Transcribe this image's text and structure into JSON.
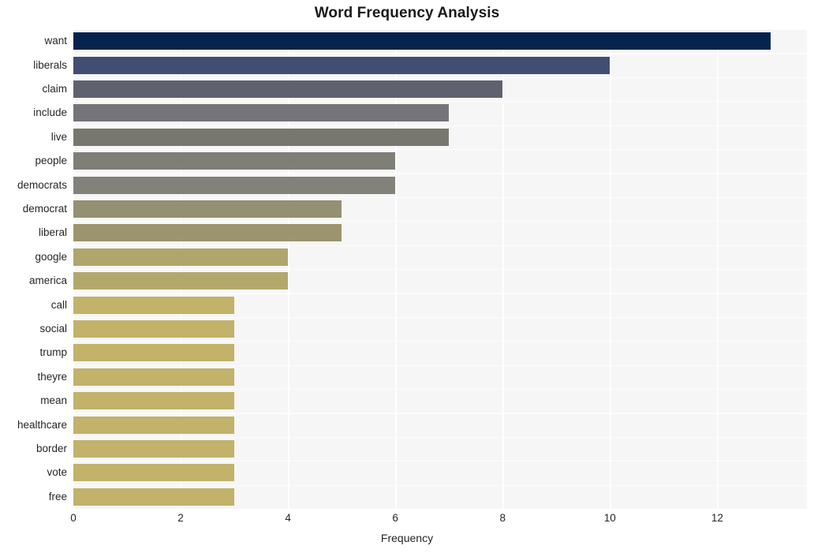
{
  "chart_data": {
    "type": "bar",
    "orientation": "horizontal",
    "title": "Word Frequency Analysis",
    "xlabel": "Frequency",
    "ylabel": "",
    "categories": [
      "want",
      "liberals",
      "claim",
      "include",
      "live",
      "people",
      "democrats",
      "democrat",
      "liberal",
      "google",
      "america",
      "call",
      "social",
      "trump",
      "theyre",
      "mean",
      "healthcare",
      "border",
      "vote",
      "free"
    ],
    "values": [
      13,
      10,
      8,
      7,
      7,
      6,
      6,
      5,
      5,
      4,
      4,
      3,
      3,
      3,
      3,
      3,
      3,
      3,
      3,
      3
    ],
    "bar_colors": [
      "#05234d",
      "#414e72",
      "#60616f",
      "#74747a",
      "#78776f",
      "#807f77",
      "#82817a",
      "#958f73",
      "#9b946f",
      "#b0a56c",
      "#b3a86c",
      "#c2b26a",
      "#c2b26a",
      "#c2b26a",
      "#c2b26a",
      "#c2b26a",
      "#c2b26a",
      "#c2b26a",
      "#c2b26a",
      "#c2b26a"
    ],
    "xticks": [
      0,
      2,
      4,
      6,
      8,
      10,
      12
    ],
    "xtick_labels": [
      "0",
      "2",
      "4",
      "6",
      "8",
      "10",
      "12"
    ],
    "xlim": [
      0,
      13.67
    ],
    "grid": true,
    "legend": null,
    "plot_background": "#f6f6f7",
    "grid_color": "#ffffff",
    "figure_background": "#ffffff"
  }
}
